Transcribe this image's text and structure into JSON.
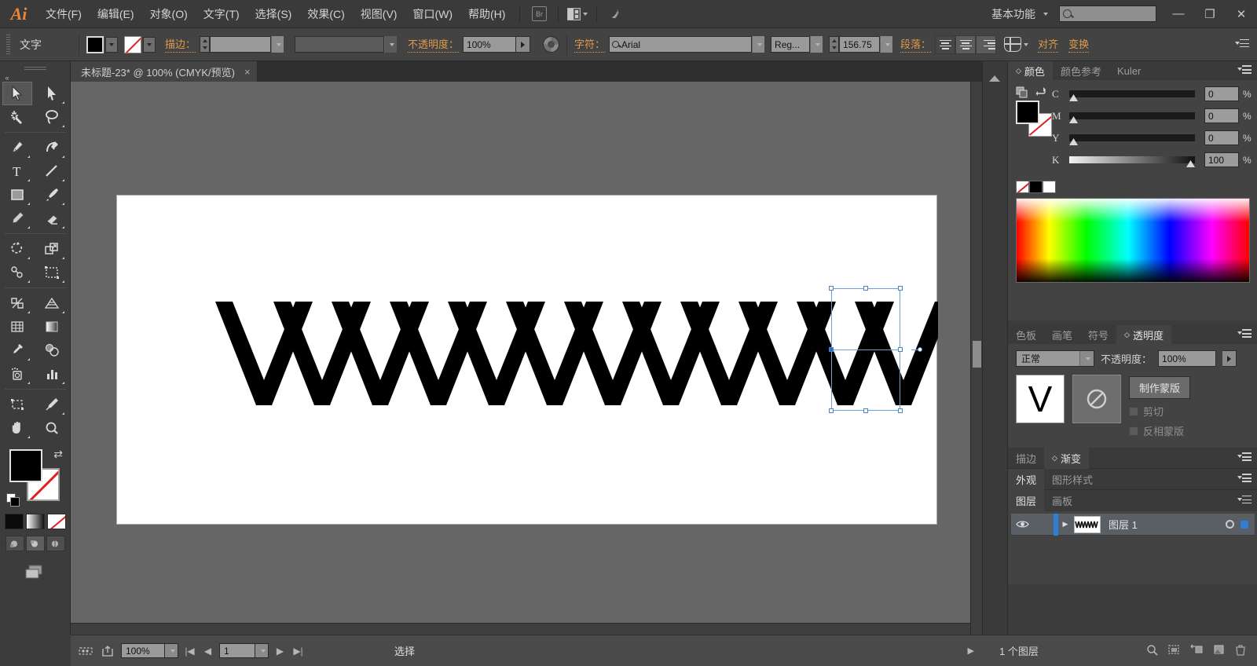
{
  "app": {
    "name": "Ai",
    "menus": [
      "文件(F)",
      "编辑(E)",
      "对象(O)",
      "文字(T)",
      "选择(S)",
      "效果(C)",
      "视图(V)",
      "窗口(W)",
      "帮助(H)"
    ],
    "bridge_label": "Br",
    "workspace": "基本功能",
    "search_placeholder": "",
    "window_minimize": "—",
    "window_restore": "❐",
    "window_close": "✕"
  },
  "control_bar": {
    "context_label": "文字",
    "fill_swatch": "black-swatch",
    "stroke_swatch": "none-swatch",
    "stroke_label": "描边：",
    "stroke_weight": "",
    "stroke_profile": "",
    "opacity_label": "不透明度：",
    "opacity_value": "100%",
    "recolor_icon": "recolor-artwork-icon",
    "character_label": "字符：",
    "font_family": "Arial",
    "font_style": "Reg...",
    "font_size": "156.75",
    "paragraph_label": "段落：",
    "align_left": "align-left",
    "align_center": "align-center",
    "align_right": "align-right",
    "envelope_icon": "envelope-distort-icon",
    "align_panel_label": "对齐",
    "transform_panel_label": "变换",
    "panel_menu_icon": "panel-menu-icon"
  },
  "document": {
    "tab_title": "未标题-23* @ 100% (CMYK/预览)",
    "close_label": "×"
  },
  "toolbar": {
    "tools": [
      {
        "name": "selection-tool",
        "selected": true
      },
      {
        "name": "direct-selection-tool",
        "selected": false
      },
      {
        "name": "magic-wand-tool",
        "selected": false
      },
      {
        "name": "lasso-tool",
        "selected": false
      },
      {
        "name": "pen-tool",
        "selected": false
      },
      {
        "name": "curvature-tool",
        "selected": false
      },
      {
        "name": "type-tool",
        "selected": false
      },
      {
        "name": "line-segment-tool",
        "selected": false
      },
      {
        "name": "rectangle-tool",
        "selected": false
      },
      {
        "name": "paintbrush-tool",
        "selected": false
      },
      {
        "name": "pencil-tool",
        "selected": false
      },
      {
        "name": "eraser-tool",
        "selected": false
      },
      {
        "name": "rotate-tool",
        "selected": false
      },
      {
        "name": "scale-tool",
        "selected": false
      },
      {
        "name": "width-tool",
        "selected": false
      },
      {
        "name": "free-transform-tool",
        "selected": false
      },
      {
        "name": "shape-builder-tool",
        "selected": false
      },
      {
        "name": "perspective-grid-tool",
        "selected": false
      },
      {
        "name": "mesh-tool",
        "selected": false
      },
      {
        "name": "gradient-tool",
        "selected": false
      },
      {
        "name": "eyedropper-tool",
        "selected": false
      },
      {
        "name": "blend-tool",
        "selected": false
      },
      {
        "name": "symbol-sprayer-tool",
        "selected": false
      },
      {
        "name": "column-graph-tool",
        "selected": false
      },
      {
        "name": "artboard-tool",
        "selected": false
      },
      {
        "name": "slice-tool",
        "selected": false
      },
      {
        "name": "hand-tool",
        "selected": false
      },
      {
        "name": "zoom-tool",
        "selected": false
      }
    ],
    "fill_color": "#000000",
    "stroke_color": "none",
    "color_modes": [
      "flat-color",
      "gradient",
      "none"
    ],
    "draw_modes": [
      "draw-normal",
      "draw-behind",
      "draw-inside"
    ],
    "screen_mode": "change-screen-mode"
  },
  "color_panel": {
    "tabs": [
      {
        "label": "颜色",
        "active": true
      },
      {
        "label": "颜色参考",
        "active": false
      },
      {
        "label": "Kuler",
        "active": false
      }
    ],
    "channels": [
      {
        "label": "C",
        "value": "0",
        "unit": "%",
        "pos": 0
      },
      {
        "label": "M",
        "value": "0",
        "unit": "%",
        "pos": 0
      },
      {
        "label": "Y",
        "value": "0",
        "unit": "%",
        "pos": 0
      },
      {
        "label": "K",
        "value": "100",
        "unit": "%",
        "pos": 100
      }
    ],
    "quick_swatches": [
      "none",
      "black",
      "white"
    ]
  },
  "transparency_panel": {
    "tabs": [
      {
        "label": "色板",
        "active": false
      },
      {
        "label": "画笔",
        "active": false
      },
      {
        "label": "符号",
        "active": false
      },
      {
        "label": "透明度",
        "active": true
      }
    ],
    "blend_mode": "正常",
    "opacity_label": "不透明度：",
    "opacity_value": "100%",
    "thumbnail_glyph": "V",
    "mask_thumbnail": "no-mask-icon",
    "make_mask_button": "制作蒙版",
    "clip_label": "剪切",
    "invert_mask_label": "反相蒙版"
  },
  "collapsed_panels": [
    {
      "tabs": [
        {
          "label": "描边",
          "active": false
        },
        {
          "label": "渐变",
          "active": true
        }
      ]
    },
    {
      "tabs": [
        {
          "label": "外观",
          "active": true
        },
        {
          "label": "图形样式",
          "active": false
        }
      ]
    },
    {
      "tabs": [
        {
          "label": "图层",
          "active": true
        },
        {
          "label": "画板",
          "active": false
        }
      ]
    }
  ],
  "layers_panel": {
    "rows": [
      {
        "name": "图层 1",
        "visible": true,
        "selected": true
      }
    ],
    "footer_count": "1 个图层",
    "footer_icons": [
      "locate-object-icon",
      "make-clipping-mask-icon",
      "create-sublayer-icon",
      "create-new-layer-icon",
      "delete-layer-icon"
    ]
  },
  "status_bar": {
    "cutting_icon": "artboard-cut-icon",
    "export_icon": "export-icon",
    "zoom_value": "100%",
    "first_page_icon": "first-artboard-icon",
    "prev_page_icon": "prev-artboard-icon",
    "page_value": "1",
    "next_page_icon": "next-artboard-icon",
    "last_page_icon": "last-artboard-icon",
    "status_text": "选择",
    "overflow_icon": "status-overflow-icon"
  },
  "artwork": {
    "text_content": "VVVVVVVVVVVVVV",
    "glyph_count": 14,
    "fill": "#000000",
    "font": "Arial",
    "size": "156.75",
    "selection": {
      "handles": 8,
      "rotate_handle": true,
      "baseline_marker": true,
      "accent_color": "#6a9fd8"
    }
  }
}
